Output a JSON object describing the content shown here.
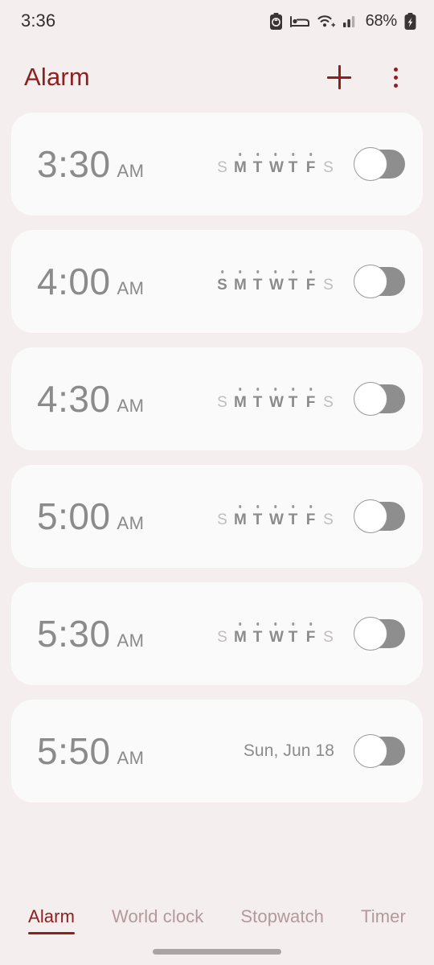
{
  "status_bar": {
    "time": "3:36",
    "battery_percent": "68%",
    "icons": [
      "power-saving-icon",
      "sleep-mode-icon",
      "wifi-icon",
      "cellular-signal-icon",
      "battery-charging-icon"
    ]
  },
  "app_bar": {
    "title": "Alarm",
    "add_label": "add-alarm",
    "menu_label": "more-options"
  },
  "colors": {
    "accent": "#8e2020",
    "background": "#f5eeee",
    "card": "#fbfafa",
    "muted_text": "#8b8b8b",
    "inactive_day": "#c0bdbd",
    "toggle_track": "#8e8e8e",
    "tab_inactive": "#b29a9c"
  },
  "day_letters": [
    "S",
    "M",
    "T",
    "W",
    "T",
    "F",
    "S"
  ],
  "alarms": [
    {
      "time": "3:30",
      "meridiem": "AM",
      "repeat_type": "days",
      "days_on": [
        false,
        true,
        true,
        true,
        true,
        true,
        false
      ],
      "enabled": false
    },
    {
      "time": "4:00",
      "meridiem": "AM",
      "repeat_type": "days",
      "days_on": [
        true,
        true,
        true,
        true,
        true,
        true,
        false
      ],
      "enabled": false
    },
    {
      "time": "4:30",
      "meridiem": "AM",
      "repeat_type": "days",
      "days_on": [
        false,
        true,
        true,
        true,
        true,
        true,
        false
      ],
      "enabled": false
    },
    {
      "time": "5:00",
      "meridiem": "AM",
      "repeat_type": "days",
      "days_on": [
        false,
        true,
        true,
        true,
        true,
        true,
        false
      ],
      "enabled": false
    },
    {
      "time": "5:30",
      "meridiem": "AM",
      "repeat_type": "days",
      "days_on": [
        false,
        true,
        true,
        true,
        true,
        true,
        false
      ],
      "enabled": false
    },
    {
      "time": "5:50",
      "meridiem": "AM",
      "repeat_type": "date",
      "date_label": "Sun, Jun 18",
      "enabled": false
    }
  ],
  "tabs": [
    {
      "label": "Alarm",
      "active": true
    },
    {
      "label": "World clock",
      "active": false
    },
    {
      "label": "Stopwatch",
      "active": false
    },
    {
      "label": "Timer",
      "active": false
    }
  ]
}
